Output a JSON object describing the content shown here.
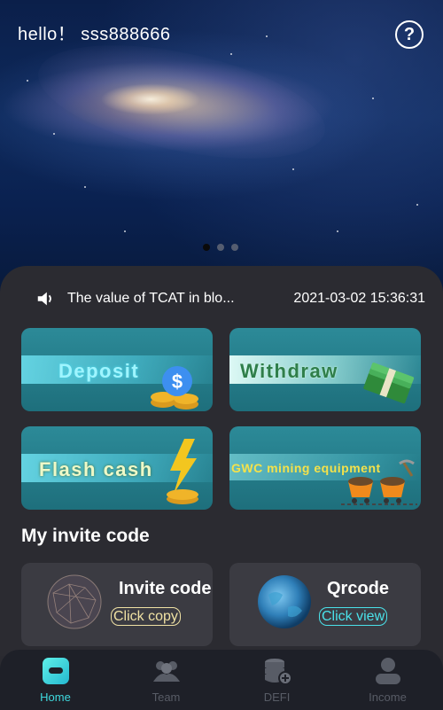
{
  "header": {
    "greeting": "hello！ sss888666",
    "help_icon": "question-circle-icon"
  },
  "banner": {
    "slides": 3,
    "active_slide": 1
  },
  "notice": {
    "icon": "speaker-icon",
    "text": "The value of TCAT in blo...",
    "timestamp": "2021-03-02 15:36:31"
  },
  "actions": [
    {
      "label": "Deposit",
      "icon": "dollar-coin-icon"
    },
    {
      "label": "Withdraw",
      "icon": "cash-stack-icon"
    },
    {
      "label": "Flash cash",
      "icon": "lightning-coins-icon"
    },
    {
      "label": "GWC mining equipment",
      "icon": "mine-cart-icon"
    }
  ],
  "invite": {
    "section_title": "My invite code",
    "invite_code_title": "Invite code",
    "invite_code_action": "Click copy",
    "qrcode_title": "Qrcode",
    "qrcode_action": "Click view"
  },
  "tabs": [
    {
      "label": "Home",
      "icon": "home-wallet-icon",
      "active": true
    },
    {
      "label": "Team",
      "icon": "team-icon",
      "active": false
    },
    {
      "label": "DEFI",
      "icon": "defi-coins-icon",
      "active": false
    },
    {
      "label": "Income",
      "icon": "user-icon",
      "active": false
    }
  ],
  "colors": {
    "accent": "#3fd9de",
    "panel": "#2b2b31",
    "tile": "#2c8a98"
  }
}
